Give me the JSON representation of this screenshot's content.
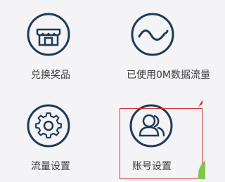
{
  "grid": {
    "items": [
      {
        "label": "兑换奖品",
        "icon": "shop-icon"
      },
      {
        "label": "已使用0M数据流量",
        "icon": "wave-icon"
      },
      {
        "label": "流量设置",
        "icon": "gear-icon"
      },
      {
        "label": "账号设置",
        "icon": "users-icon"
      }
    ]
  },
  "colors": {
    "icon_stroke": "#1f3a57",
    "label_text": "#3a3a3a",
    "highlight_border": "#d32f2f",
    "background": "#f4f4f6"
  }
}
